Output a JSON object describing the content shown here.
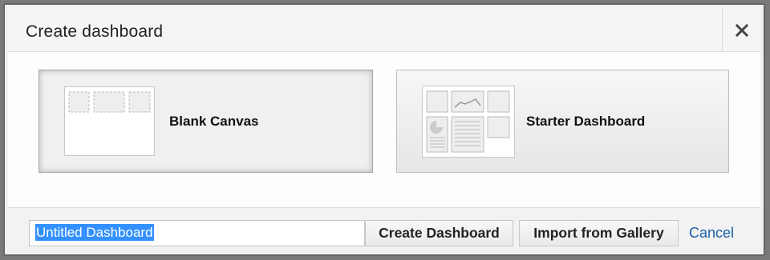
{
  "dialog": {
    "title": "Create dashboard",
    "close_icon": "close-icon"
  },
  "options": [
    {
      "label": "Blank Canvas",
      "selected": true,
      "thumbnail_icon": "blank-canvas-thumbnail-icon"
    },
    {
      "label": "Starter Dashboard",
      "selected": false,
      "thumbnail_icon": "starter-dashboard-thumbnail-icon"
    }
  ],
  "footer": {
    "name_input": {
      "value": "Untitled Dashboard"
    },
    "create_label": "Create Dashboard",
    "import_label": "Import from Gallery",
    "cancel_label": "Cancel"
  },
  "colors": {
    "link": "#1a5fa8",
    "selection": "#3391ff"
  }
}
